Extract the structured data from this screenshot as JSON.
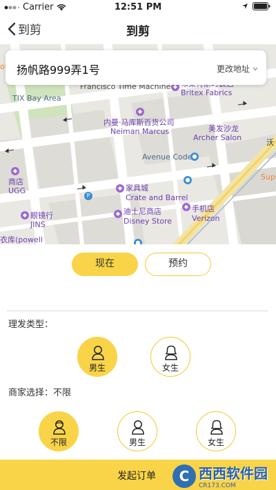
{
  "status_bar": {
    "carrier": "Carrier",
    "time": "12:51 PM"
  },
  "nav": {
    "back_label": "到剪",
    "title": "到剪"
  },
  "map": {
    "address": "扬帆路999弄1号",
    "change_address": "更改地址",
    "labels": [
      "Francisco Time Machine",
      "TIX Bay Area",
      "布莱特斯时装店",
      "Britex Fabrics",
      "内曼·马库斯百货公司",
      "Neiman Marcus",
      "美发沙龙",
      "Archer Salon",
      "Avenue Code",
      "商店",
      "UGG",
      "家具城",
      "Crate and Barrel",
      "眼镜行",
      "JINS",
      "迪士尼商店",
      "Disney Store",
      "手机店",
      "Verizon",
      "衣库(powell",
      "沃",
      "Supe",
      "oya"
    ]
  },
  "mode": {
    "now": "现在",
    "reserve": "预约",
    "selected": "now"
  },
  "haircut_type": {
    "label": "理发类型：",
    "options": [
      "男生",
      "女生"
    ],
    "selected": "男生"
  },
  "merchant": {
    "label": "商家选择：不限",
    "options": [
      "不限",
      "男生",
      "女生"
    ],
    "selected": "不限"
  },
  "bottom": {
    "label": "发起订单",
    "watermark_text": "西西软件园",
    "watermark_sub": "CR173.COM"
  },
  "colors": {
    "accent": "#f9d448",
    "accent_border": "#f5c82d"
  }
}
